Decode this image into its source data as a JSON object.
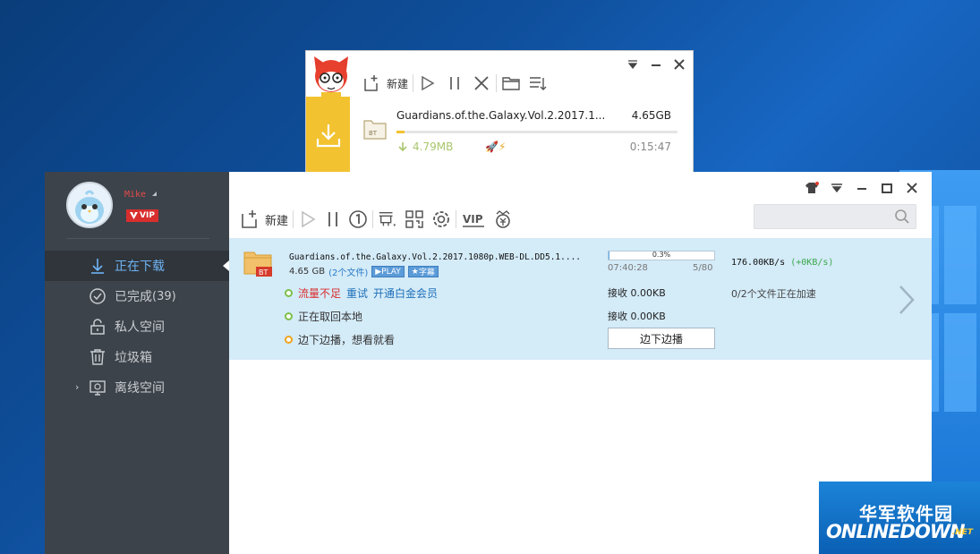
{
  "colors": {
    "accent_yellow": "#f2c230",
    "sidebar_bg": "#3d434a",
    "active_blue": "#6fb3f4",
    "task_bg": "#d4ebf8",
    "vip_red": "#d92e2e"
  },
  "mini_window": {
    "new_label": "新建",
    "task_name": "Guardians.of.the.Galaxy.Vol.2.2017.1...",
    "task_size": "4.65GB",
    "speed": "4.79MB",
    "time_left": "0:15:47",
    "progress": 0.03,
    "icons": [
      "new-task-icon",
      "play-icon",
      "pause-icon",
      "delete-icon",
      "folder-icon",
      "sort-icon",
      "dropdown-icon",
      "minimize-icon",
      "close-icon",
      "download-icon",
      "bt-file-icon"
    ]
  },
  "user": {
    "name": "Mike",
    "vip_label": "VIP"
  },
  "sidebar": {
    "items": [
      {
        "label": "正在下载",
        "count": "",
        "icon": "download-icon",
        "active": true
      },
      {
        "label": "已完成",
        "count": "(39)",
        "icon": "check-circle-icon",
        "active": false
      },
      {
        "label": "私人空间",
        "count": "",
        "icon": "lock-icon",
        "active": false
      },
      {
        "label": "垃圾箱",
        "count": "",
        "icon": "trash-icon",
        "active": false
      },
      {
        "label": "离线空间",
        "count": "",
        "icon": "cloud-monitor-icon",
        "active": false
      }
    ]
  },
  "toolbar": {
    "new_label": "新建",
    "search_placeholder": "",
    "icons": [
      "new-task-icon",
      "play-icon",
      "pause-icon",
      "limit-speed-icon",
      "plan-icon",
      "qr-code-icon",
      "settings-icon",
      "vip-icon",
      "yuan-icon",
      "skin-icon",
      "menu-icon",
      "minimize-icon",
      "maximize-icon",
      "close-icon"
    ]
  },
  "task": {
    "title": "Guardians.of.the.Galaxy.Vol.2.2017.1080p.WEB-DL.DD5.1....",
    "size": "4.65 GB",
    "file_count": "(2个文件)",
    "play_tag": "PLAY",
    "subtitle_tag": "字幕",
    "progress_text": "0.3%",
    "progress": 0.003,
    "eta": "07:40:28",
    "pieces": "5/80",
    "speed": "176.00KB/s",
    "speed_boost": "(+0KB/s)",
    "status_lines": [
      {
        "prefix": "流量不足",
        "link1": "重试",
        "link2": "开通白金会员",
        "color": "green"
      },
      {
        "text": "正在取回本地",
        "color": "green"
      },
      {
        "text": "边下边播，想看就看",
        "color": "orange"
      }
    ],
    "recv_label_1": "接收 0.00KB",
    "recv_label_2": "接收 0.00KB",
    "accel_text": "0/2个文件正在加速",
    "edge_button": "边下边播"
  },
  "watermark": {
    "cn": "华军软件园",
    "en": "ONLINEDOWN",
    "suffix": ".NET"
  }
}
